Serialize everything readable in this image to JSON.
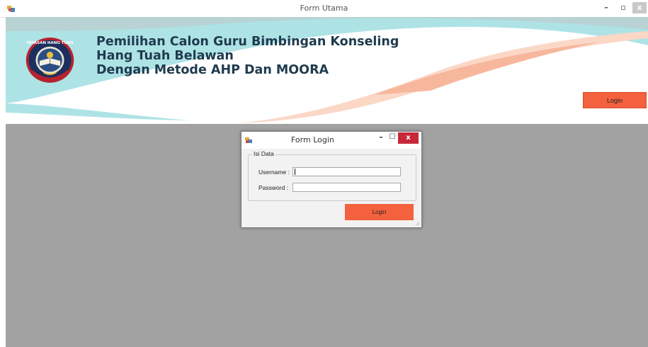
{
  "window": {
    "title": "Form Utama",
    "controls": {
      "minimize": "–",
      "restore": "▫",
      "close": "x"
    }
  },
  "banner": {
    "title_line1": "Pemilihan Calon Guru Bimbingan Konseling",
    "title_line2": "Hang Tuah Belawan",
    "title_line3": "Dengan Metode AHP Dan MOORA",
    "logo_text": "YAYASAN HANG TUAH",
    "login_label": "Login"
  },
  "dialog": {
    "title": "Form Login",
    "controls": {
      "minimize": "–",
      "maximize": "☐",
      "close": "x"
    },
    "group_label": "Isi Data",
    "username_label": "Username :",
    "password_label": "Password :",
    "username_value": "",
    "password_value": "",
    "login_label": "Login"
  },
  "colors": {
    "accent_orange": "#f4613e",
    "banner_cyan": "#aee3e6",
    "mdi_background": "#a2a2a2",
    "dialog_close": "#c7283a"
  }
}
